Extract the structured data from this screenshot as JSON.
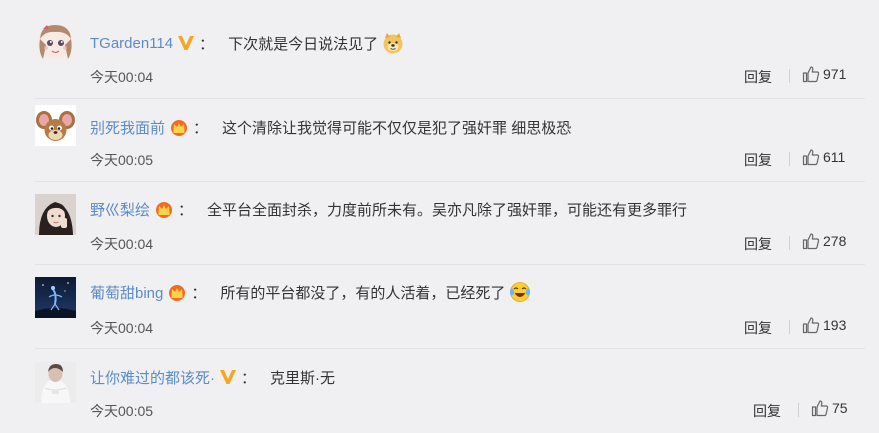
{
  "comments": [
    {
      "username": "TGarden114",
      "badge": "v-badge-icon",
      "text": "下次就是今日说法见了",
      "emoji": "doge-emoji",
      "time": "今天00:04",
      "reply": "回复",
      "likes": "971"
    },
    {
      "username": "别死我面前",
      "badge": "crown-badge-icon",
      "text": "这个清除让我觉得可能不仅仅是犯了强奸罪 细思极恐",
      "emoji": "",
      "time": "今天00:05",
      "reply": "回复",
      "likes": "611"
    },
    {
      "username": "野巛梨绘",
      "badge": "crown-badge-icon",
      "text": "全平台全面封杀，力度前所未有。吴亦凡除了强奸罪，可能还有更多罪行",
      "emoji": "",
      "time": "今天00:04",
      "reply": "回复",
      "likes": "278"
    },
    {
      "username": "葡萄甜bing",
      "badge": "crown-badge-icon",
      "text": "所有的平台都没了，有的人活着，已经死了",
      "emoji": "laugh-cry-emoji",
      "time": "今天00:04",
      "reply": "回复",
      "likes": "193"
    },
    {
      "username": "让你难过的都该死·",
      "badge": "v-badge-icon",
      "text": "克里斯·无",
      "emoji": "",
      "time": "今天00:05",
      "reply": "回复",
      "likes": "75"
    }
  ],
  "colors": {
    "background": "#f0f0f3",
    "username": "#5b8cc5",
    "v_badge": "#f5a623",
    "crown_badge": "#f26b21"
  }
}
